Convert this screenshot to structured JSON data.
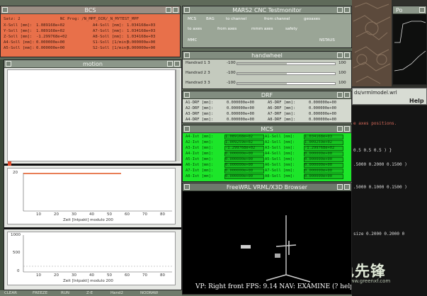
{
  "bcs": {
    "title": "BCS",
    "header": [
      "Satz: 2",
      "NC Prog: /N_MPF_DIR/_N_MYTEST_MPF"
    ],
    "rows": [
      [
        "X-Soll [mm]:",
        "1.089168e+02",
        "A4-Soll [mm]:",
        "1.034168e+03"
      ],
      [
        "Y-Soll [mm]:",
        "1.089168e+02",
        "A7-Soll [mm]:",
        "1.034168e+03"
      ],
      [
        "Z-Soll [mm]:",
        "-1.299768e+02",
        "A8-Soll [mm]:",
        "1.034168e+03"
      ],
      [
        "A4-Soll [mm]:",
        "0.000000e+00",
        "S1-Soll [1/min]:",
        "0.000000e+00"
      ],
      [
        "A5-Soll [mm]:",
        "0.000000e+00",
        "S2-Soll [1/min]:",
        "0.000000e+00"
      ]
    ]
  },
  "motion": {
    "title": "motion",
    "plot2": {
      "ytick": "20",
      "xticks": [
        "10",
        "20",
        "30",
        "40",
        "50",
        "60",
        "70",
        "80"
      ],
      "xlabel": "Zeit [Intpakt] modulo 200"
    },
    "plot3": {
      "yticks": [
        "1000",
        "500",
        "0"
      ],
      "xticks": [
        "10",
        "20",
        "30",
        "40",
        "50",
        "60",
        "70",
        "80"
      ],
      "xlabel": "Zeit [Intpakt] modulo 200"
    }
  },
  "cnc": {
    "title": "MARS2 CNC Testmonitor",
    "row1": [
      "MCS",
      "BAG",
      "to channel",
      "from channel",
      "geoaxes"
    ],
    "row2": [
      "to axes",
      "from axes",
      "mmm axes",
      "safety"
    ],
    "row3": [
      "MMC",
      "NSTAUS"
    ]
  },
  "handwheel": {
    "title": "handwheel",
    "rows": [
      {
        "label": "Handrad 1 3",
        "min": "-100",
        "max": "100"
      },
      {
        "label": "Handrad 2 3",
        "min": "-100",
        "max": "100"
      },
      {
        "label": "Handrad 3 3",
        "min": "-100",
        "max": "100"
      }
    ]
  },
  "drf": {
    "title": "DRF",
    "rows": [
      [
        "A1-DRF [mm]:",
        "0.000000e+00",
        "A5-DRF [mm]:",
        "0.000000e+00"
      ],
      [
        "A2-DRF [mm]:",
        "0.000000e+00",
        "A6-DRF [mm]:",
        "0.000000e+00"
      ],
      [
        "A3-DRF [mm]:",
        "0.000000e+00",
        "A7-DRF [mm]:",
        "0.000000e+00"
      ],
      [
        "A4-DRF [mm]:",
        "0.000000e+00",
        "A8-DRF [mm]:",
        "0.000000e+00"
      ]
    ]
  },
  "mcs": {
    "title": "MCS",
    "rows": [
      [
        "A4-Ist [mm]:",
        "1.089168e+02",
        "A1-Soll [mm]:",
        "1.034168e+03"
      ],
      [
        "A2-Ist [mm]:",
        "1.009259e+02",
        "A2-Soll [mm]:",
        "1.009259e+02"
      ],
      [
        "A3-Ist [mm]:",
        "-1.299768e+02",
        "A3-Soll [mm]:",
        "-1.299768e+02"
      ],
      [
        "A4-Ist [mm]:",
        "0.000000e+00",
        "A4-Soll [mm]:",
        "0.000000e+00"
      ],
      [
        "A5-Ist [mm]:",
        "0.000000e+00",
        "A5-Soll [mm]:",
        "0.000000e+00"
      ],
      [
        "A6-Ist [mm]:",
        "0.000000e+00",
        "A6-Soll [mm]:",
        "0.000000e+00"
      ],
      [
        "A7-Ist [mm]:",
        "0.000000e+00",
        "A7-Soll [mm]:",
        "0.000000e+00"
      ],
      [
        "A8-Ist [mm]:",
        "0.000000e+00",
        "A8-Soll [mm]:",
        "0.000000e+00"
      ]
    ]
  },
  "vrml": {
    "title": "FreeWRL VRML/X3D Browser",
    "status": "VP: Right front   FPS: 9.14  NAV: EXAMINE  (? help)"
  },
  "right": {
    "top_title": "Po",
    "path": "ds/vrmlmodel.wrl",
    "help": "Help",
    "code_lines": [
      "e axes positions.",
      "0.5 0.5 0.5 ) }",
      ".5000 0.2000 0.1500 )",
      ".5000 0.1000 0.1500 )",
      "size 0.2000 0.2000 0"
    ],
    "watermark": "绿色先锋",
    "watermark_url": "www.greenxf.com"
  },
  "bottombar": [
    "CLEAR",
    "FREEZE",
    "RUN",
    "Z-E",
    "Hand2",
    "NODRAW"
  ]
}
